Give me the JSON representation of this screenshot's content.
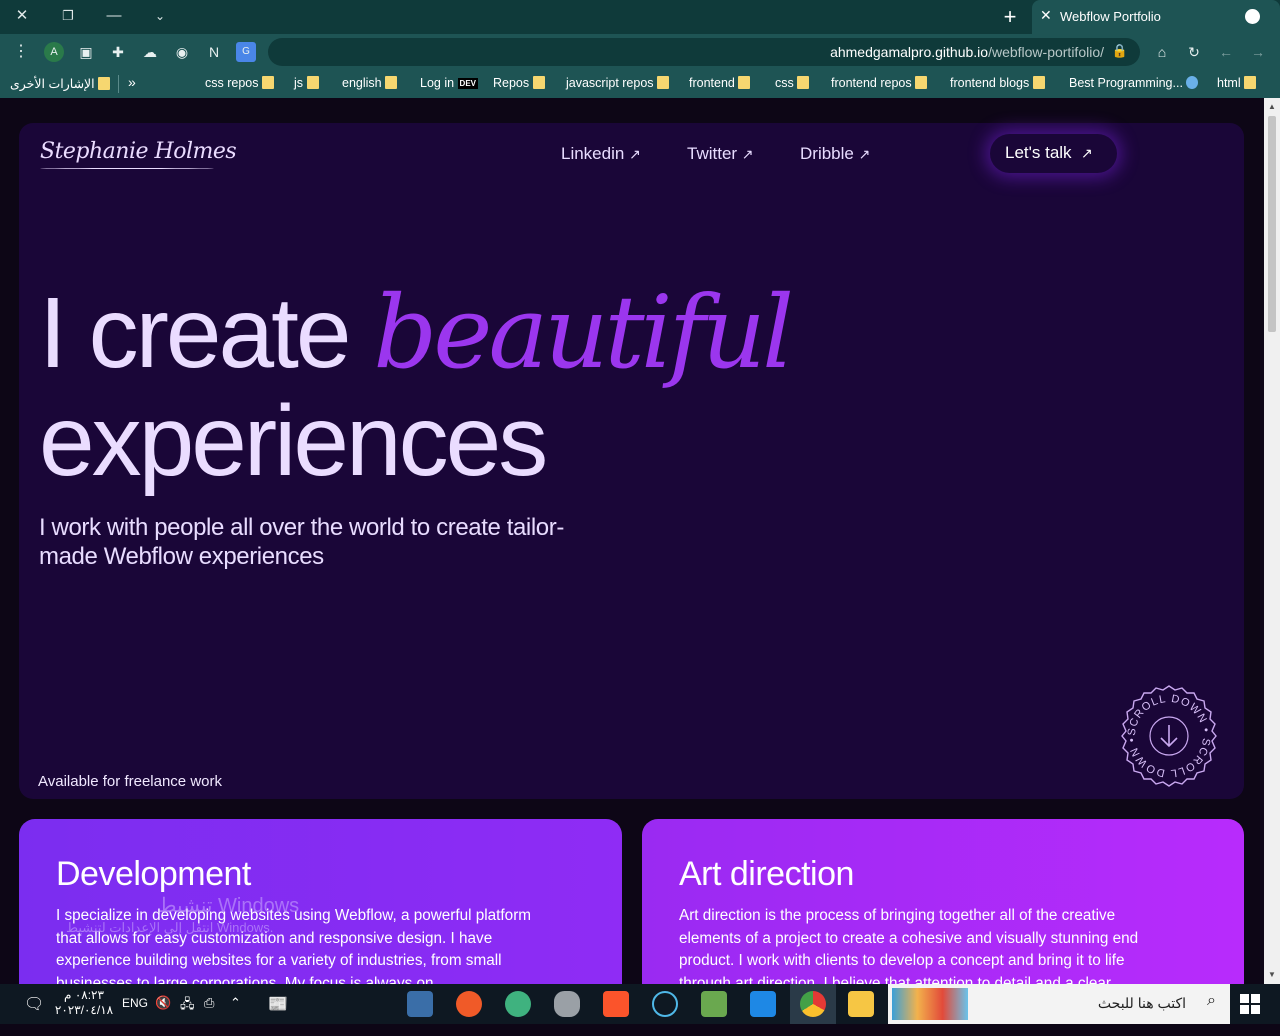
{
  "browser": {
    "tab_title": "Webflow Portfolio",
    "url_domain": "ahmedgamalpro.github.io",
    "url_path": "/webflow-portifolio/",
    "bookmarks": [
      "html",
      "Best Programming...",
      "frontend blogs",
      "frontend repos",
      "css",
      "frontend",
      "javascript repos",
      "Repos",
      "Log in",
      "english",
      "js",
      "css repos"
    ],
    "bookmarks_overflow": "»",
    "other_bookmarks": "الإشارات الأخرى",
    "dev_badge": "DEV"
  },
  "site": {
    "logo": "Stephanie Holmes",
    "nav": [
      {
        "label": "Linkedin"
      },
      {
        "label": "Twitter"
      },
      {
        "label": "Dribble"
      }
    ],
    "nav_arrow": "↗",
    "cta": "Let's talk",
    "heading_part1": "I create ",
    "heading_emphasis": "beautiful",
    "heading_part2": "experiences",
    "subtitle": "I work with people all over the world to create tailor-made Webflow experiences",
    "available": "Available for freelance work",
    "scroll_badge_text": "SCROLL DOWN • SCROLL DOWN •",
    "cards": [
      {
        "title": "Development",
        "body": "I specialize in developing websites using Webflow, a powerful platform that allows for easy customization and responsive design. I have experience building websites for a variety of industries, from small businesses to large corporations. My focus is always on"
      },
      {
        "title": "Art direction",
        "body": "Art direction is the process of bringing together all of the creative elements of a project to create a cohesive and visually stunning end product. I work with clients to develop a concept and bring it to life through art direction. I believe that attention to detail and a clear"
      }
    ]
  },
  "windows": {
    "watermark_title": "تنشيط Windows",
    "watermark_sub": "انتقل إلى الإعدادات لتنشيط Windows.",
    "time": "٠٨:٢٣ م",
    "date": "٢٠٢٣/٠٤/١٨",
    "lang": "ENG",
    "search_placeholder": "اكتب هنا للبحث"
  },
  "colors": {
    "hero_bg": "#1a0638",
    "accent": "#9b36ee",
    "text": "#eadcff"
  }
}
